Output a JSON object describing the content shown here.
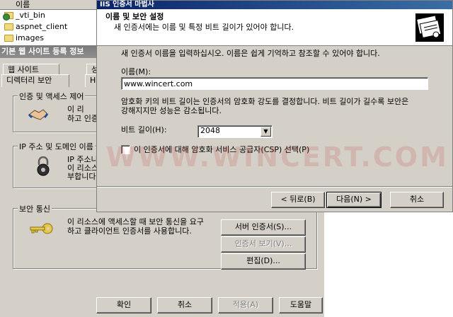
{
  "explorer": {
    "header": "이름",
    "items": [
      "_vti_bin",
      "aspnet_client",
      "images"
    ]
  },
  "properties": {
    "title": "기본 웹 사이트 등록 정보",
    "tabs_row1": [
      "웹 사이트",
      "성"
    ],
    "tabs_row2": [
      "디렉터리 보안",
      "H"
    ],
    "auth_group": {
      "label": "인증 및 액세스 제어",
      "text_line1": "이 리",
      "text_line2": "하고 인증"
    },
    "ip_group": {
      "label": "IP 주소 및 도메인 이름",
      "text_line1": "IP 주소나",
      "text_line2": "이 리소스",
      "text_line3": "부합니다"
    },
    "secure_group": {
      "label": "보안 통신",
      "text_line1": "이 리소스에 액세스할 때 보안 통신을 요구",
      "text_line2": "하고 클라이언트 인증서를 사용합니다.",
      "server_cert_button": "서버 인증서(S)...",
      "view_cert_button": "인증서 보기(V)...",
      "edit_button": "편집(D)..."
    },
    "ok_button": "확인",
    "cancel_button": "취소",
    "apply_button": "적용(A)",
    "help_button": "도움말"
  },
  "wizard": {
    "title": "IIS 인증서 마법사",
    "header_title": "이름 및 보안 설정",
    "header_subtitle": "새 인증서에는 이름 및 특정 비트 길이가 있어야 합니다.",
    "intro_text": "새 인증서 이름을 입력하십시오. 이름은 쉽게 기억하고 참조할 수 있어야 합니다.",
    "name_label": "이름(M):",
    "name_value": "www.wincert.com",
    "bitlength_text_line1": "암호화 키의 비트 길이는 인증서의 암호화 강도를 결정합니다. 비트 길이가 길수록 보안은",
    "bitlength_text_line2": "강해지지만 성능은 감소됩니다.",
    "bitlength_label": "비트 길이(H):",
    "bitlength_value": "2048",
    "csp_checkbox_label": "이 인증서에 대해 암호화 서비스 공급자(CSP) 선택(P)",
    "csp_checked": false,
    "back_button": "< 뒤로(B)",
    "next_button": "다음(N) >",
    "cancel_button": "취소"
  },
  "watermark": "WWW.WINCERT.COM"
}
